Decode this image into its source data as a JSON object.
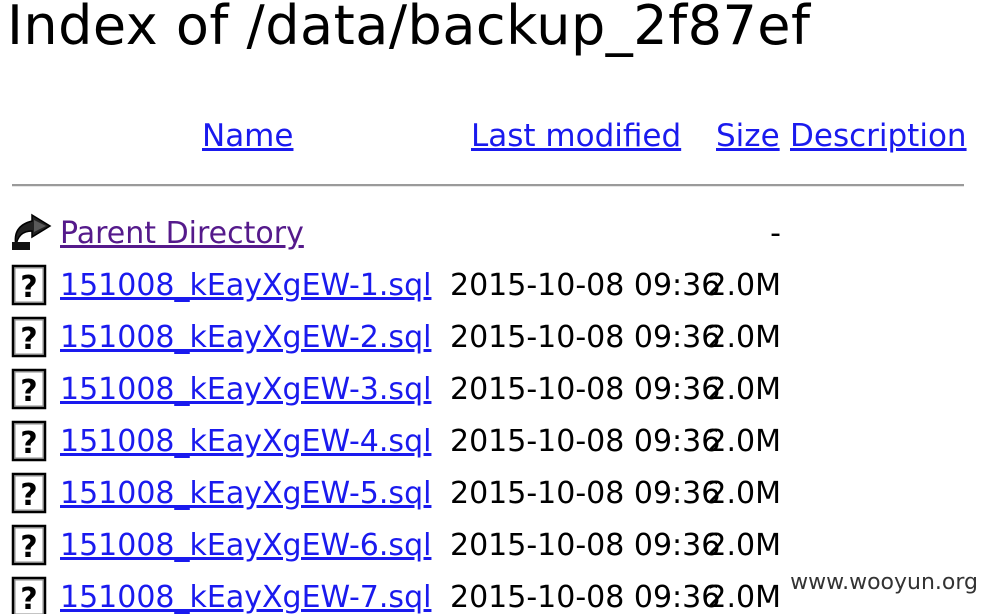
{
  "title": "Index of /data/backup_2f87ef",
  "columns": {
    "name": "Name",
    "last_modified": "Last modified",
    "size": "Size",
    "description": "Description"
  },
  "parent": {
    "label": "Parent Directory",
    "size": "-",
    "icon": "back-arrow-icon"
  },
  "files": [
    {
      "name": "151008_kEayXgEW-1.sql",
      "modified": "2015-10-08 09:36",
      "size": "2.0M",
      "icon": "unknown-file-icon"
    },
    {
      "name": "151008_kEayXgEW-2.sql",
      "modified": "2015-10-08 09:36",
      "size": "2.0M",
      "icon": "unknown-file-icon"
    },
    {
      "name": "151008_kEayXgEW-3.sql",
      "modified": "2015-10-08 09:36",
      "size": "2.0M",
      "icon": "unknown-file-icon"
    },
    {
      "name": "151008_kEayXgEW-4.sql",
      "modified": "2015-10-08 09:36",
      "size": "2.0M",
      "icon": "unknown-file-icon"
    },
    {
      "name": "151008_kEayXgEW-5.sql",
      "modified": "2015-10-08 09:36",
      "size": "2.0M",
      "icon": "unknown-file-icon"
    },
    {
      "name": "151008_kEayXgEW-6.sql",
      "modified": "2015-10-08 09:36",
      "size": "2.0M",
      "icon": "unknown-file-icon"
    },
    {
      "name": "151008_kEayXgEW-7.sql",
      "modified": "2015-10-08 09:36",
      "size": "2.0M",
      "icon": "unknown-file-icon"
    }
  ],
  "watermark": "www.wooyun.org",
  "colors": {
    "link": "#1a1aee",
    "visited": "#551a8b",
    "rule": "#9a9a9a"
  }
}
